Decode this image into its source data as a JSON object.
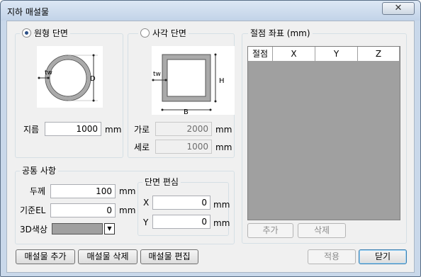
{
  "window": {
    "title": "지하 매설물",
    "close_symbol": "✕"
  },
  "circle_section": {
    "label": "원형 단면",
    "selected": true,
    "tw_label": "tw",
    "d_label": "D",
    "diameter_label": "지름",
    "diameter_value": "1000",
    "diameter_unit": "mm"
  },
  "rect_section": {
    "label": "사각 단면",
    "selected": false,
    "tw_label": "tw",
    "h_label": "H",
    "b_label": "B",
    "width_label": "가로",
    "width_value": "2000",
    "width_unit": "mm",
    "height_label": "세로",
    "height_value": "1000",
    "height_unit": "mm"
  },
  "common": {
    "legend": "공통 사항",
    "thickness_label": "두께",
    "thickness_value": "100",
    "thickness_unit": "mm",
    "base_el_label": "기준EL",
    "base_el_value": "0",
    "base_el_unit": "mm",
    "color_label": "3D색상",
    "color_value": "#a0a0a0",
    "dropdown_symbol": "▼"
  },
  "offset": {
    "legend": "단면  편심",
    "x_label": "X",
    "x_value": "0",
    "x_unit": "mm",
    "y_label": "Y",
    "y_value": "0",
    "y_unit": "mm"
  },
  "nodes": {
    "legend": "절점 좌표 (mm)",
    "columns": [
      "절점",
      "X",
      "Y",
      "Z"
    ],
    "rows": [],
    "add_label": "추가",
    "delete_label": "삭제"
  },
  "buttons": {
    "add_pipe": "매설물 추가",
    "delete_pipe": "매설물 삭제",
    "edit_pipe": "매설물 편집",
    "apply": "적용",
    "close": "닫기"
  },
  "colors": {
    "window_frame": "#c9d8ea",
    "client_bg": "#f0f0f0",
    "grid_bg": "#a0a0a0",
    "radio_dot": "#2b4f86"
  }
}
